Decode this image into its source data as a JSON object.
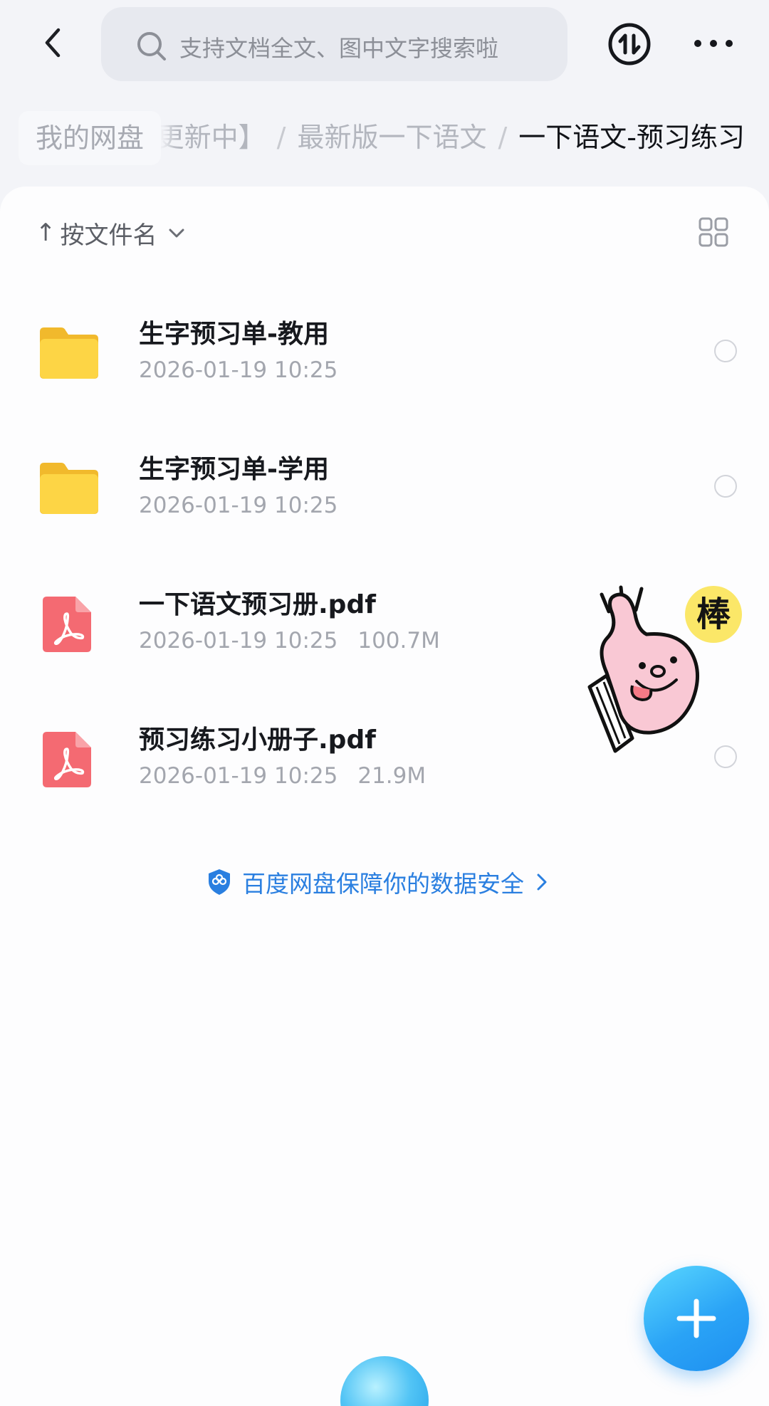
{
  "top_bar": {
    "back_icon": "chevron-left-icon",
    "search_placeholder": "支持文档全文、图中文字搜索啦",
    "transfer_icon": "transfer-updown-icon",
    "more_icon": "more-dots-icon"
  },
  "breadcrumb": {
    "root": "我的网盘",
    "items": [
      "更新中】",
      "最新版一下语文",
      "一下语文-预习练习"
    ],
    "separator": "/"
  },
  "toolbar": {
    "sort_arrow": "↑",
    "sort_label": "按文件名",
    "grid_icon": "grid-view-icon"
  },
  "files": [
    {
      "name": "生字预习单-教用",
      "date": "2026-01-19 10:25",
      "size": "",
      "type": "folder"
    },
    {
      "name": "生字预习单-学用",
      "date": "2026-01-19 10:25",
      "size": "",
      "type": "folder"
    },
    {
      "name": "一下语文预习册.pdf",
      "date": "2026-01-19 10:25",
      "size": "100.7M",
      "type": "pdf"
    },
    {
      "name": "预习练习小册子.pdf",
      "date": "2026-01-19 10:25",
      "size": "21.9M",
      "type": "pdf"
    }
  ],
  "safety_notice": {
    "text": "百度网盘保障你的数据安全",
    "icon": "shield-icon"
  },
  "sticker": {
    "text": "棒",
    "icon": "thumbs-up-sticker"
  },
  "fab": {
    "icon": "plus-icon"
  },
  "colors": {
    "background": "#f3f4f8",
    "card": "#fdfdfe",
    "folder_yellow": "#fcd03f",
    "pdf_red": "#f46a72",
    "link_blue": "#2a7fe0",
    "fab_blue": "#2aa3f6"
  }
}
